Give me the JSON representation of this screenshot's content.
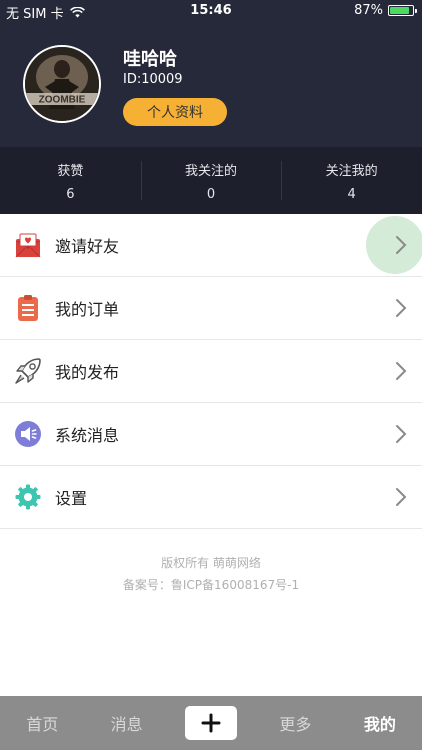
{
  "status_bar": {
    "carrier": "无 SIM 卡",
    "time": "15:46",
    "battery_percent_text": "87%",
    "battery_level": 0.87
  },
  "profile": {
    "username": "哇哈哈",
    "user_id": "ID:10009",
    "profile_button_label": "个人资料",
    "avatar_text": "ZOOMBIE"
  },
  "stats": [
    {
      "label": "获赞",
      "value": "6"
    },
    {
      "label": "我关注的",
      "value": "0"
    },
    {
      "label": "关注我的",
      "value": "4"
    }
  ],
  "menu": [
    {
      "label": "邀请好友",
      "icon": "invite-envelope-icon"
    },
    {
      "label": "我的订单",
      "icon": "clipboard-order-icon"
    },
    {
      "label": "我的发布",
      "icon": "rocket-icon"
    },
    {
      "label": "系统消息",
      "icon": "speaker-icon"
    },
    {
      "label": "设置",
      "icon": "gear-icon"
    }
  ],
  "footer": {
    "copyright": "版权所有 萌萌网络",
    "icp": "备案号：鲁ICP备16008167号-1"
  },
  "tabs": {
    "home": "首页",
    "messages": "消息",
    "more": "更多",
    "mine": "我的"
  },
  "colors": {
    "header_bg": "#262939",
    "stats_bg": "#1d1f2d",
    "accent_button": "#f6b135",
    "tab_bar_bg": "#8c8c8c",
    "ripple": "#cfe9d4"
  }
}
